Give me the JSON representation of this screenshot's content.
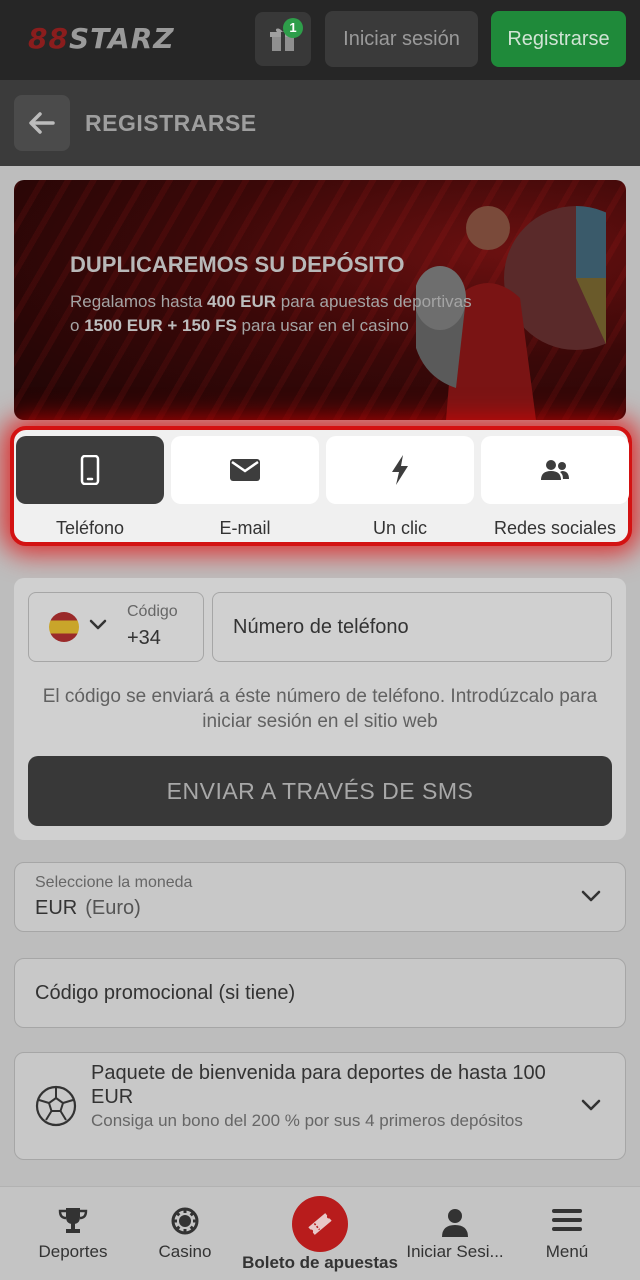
{
  "header": {
    "logo_mark": "88",
    "logo_text": "STARZ",
    "gift_count": "1",
    "login_label": "Iniciar sesión",
    "register_label": "Registrarse"
  },
  "page": {
    "title": "REGISTRARSE"
  },
  "banner": {
    "title": "DUPLICAREMOS SU DEPÓSITO",
    "line1_pre": "Regalamos hasta ",
    "line1_bold": "400 EUR",
    "line1_post": " para apuestas deportivas",
    "line2_pre": "o ",
    "line2_bold": "1500 EUR + 150 FS",
    "line2_post": " para usar en el casino"
  },
  "methods": {
    "items": [
      {
        "label": "Teléfono",
        "icon": "phone-icon",
        "active": true
      },
      {
        "label": "E-mail",
        "icon": "envelope-icon",
        "active": false
      },
      {
        "label": "Un clic",
        "icon": "lightning-icon",
        "active": false
      },
      {
        "label": "Redes sociales",
        "icon": "users-icon",
        "active": false
      }
    ]
  },
  "phone": {
    "code_label": "Código",
    "code_value": "+34",
    "number_placeholder": "Número de teléfono",
    "hint": "El código se enviará a éste número de teléfono. Introdúzcalo para iniciar sesión en el sitio web",
    "send_label": "ENVIAR A TRAVÉS DE SMS"
  },
  "currency": {
    "label": "Seleccione la moneda",
    "code": "EUR",
    "name": "(Euro)"
  },
  "promo": {
    "placeholder": "Código promocional (si tiene)"
  },
  "bonus": {
    "title": "Paquete de bienvenida para deportes de hasta 100 EUR",
    "subtitle": "Consiga un bono del 200 % por sus 4 primeros depósitos"
  },
  "bottom_nav": {
    "sports": "Deportes",
    "casino": "Casino",
    "betslip": "Boleto de apuestas",
    "login": "Iniciar Sesi...",
    "menu": "Menú"
  },
  "colors": {
    "accent_green": "#1f8a3a",
    "highlight_red": "#d31212",
    "dark": "#383838"
  }
}
